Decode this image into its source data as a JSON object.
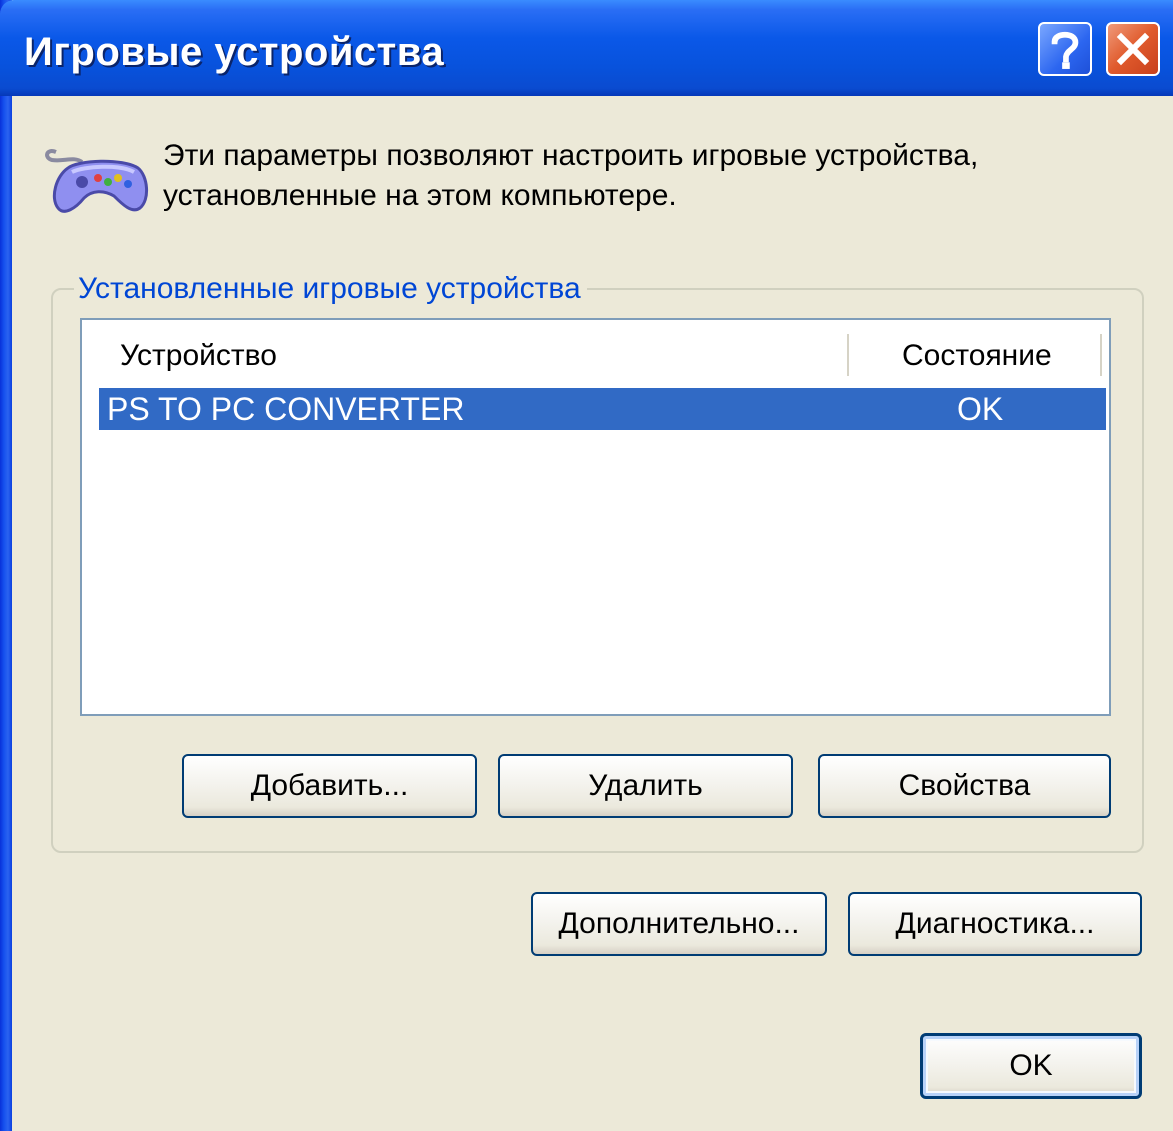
{
  "window": {
    "title": "Игровые устройства",
    "help_icon": "help-icon",
    "close_icon": "close-icon"
  },
  "intro": {
    "icon": "gamepad-icon",
    "text": "Эти параметры позволяют настроить игровые устройства, установленные на этом компьютере."
  },
  "group": {
    "label": "Установленные игровые устройства",
    "columns": {
      "device": "Устройство",
      "status": "Состояние"
    },
    "rows": [
      {
        "device": "PS TO PC CONVERTER",
        "status": "OK",
        "selected": true
      }
    ],
    "buttons": {
      "add": "Добавить...",
      "remove": "Удалить",
      "properties": "Свойства"
    }
  },
  "footer": {
    "advanced": "Дополнительно...",
    "diagnostics": "Диагностика...",
    "ok": "OK"
  },
  "colors": {
    "dialog_bg": "#ece9d8",
    "titlebar": "#0852dc",
    "selection": "#316ac5",
    "group_label": "#0046d5",
    "button_border": "#003c74"
  }
}
